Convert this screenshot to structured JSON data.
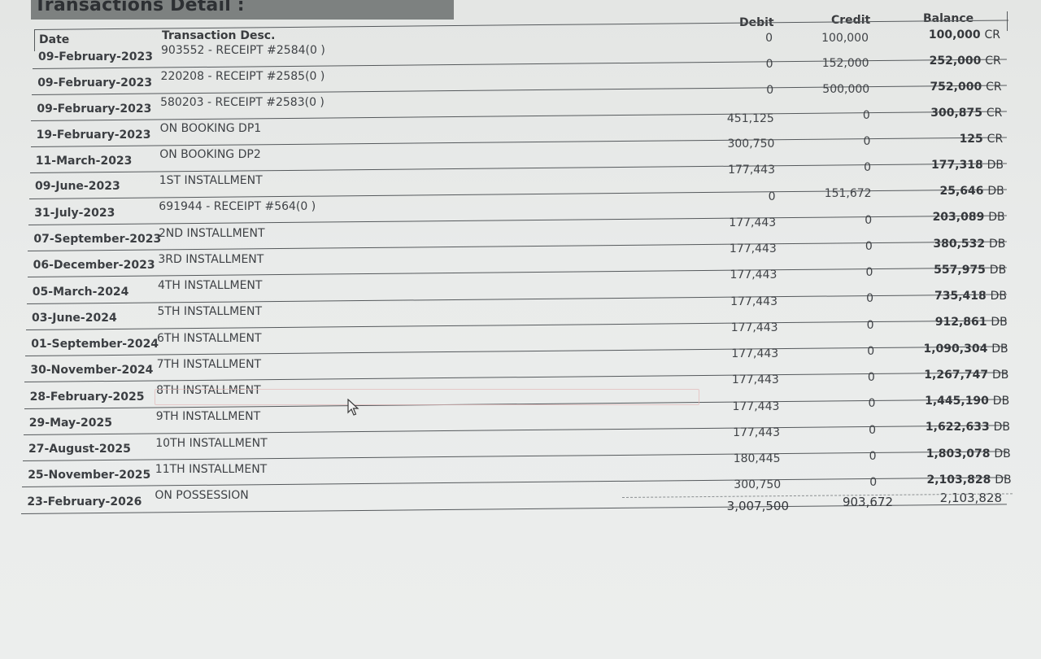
{
  "title": "Transactions Detail :",
  "columns": {
    "date": "Date",
    "desc": "Transaction Desc.",
    "debit": "Debit",
    "credit": "Credit",
    "balance": "Balance"
  },
  "rows": [
    {
      "date": "09-February-2023",
      "desc": "903552 - RECEIPT #2584(0      )",
      "debit": "0",
      "credit": "100,000",
      "balance": "100,000",
      "type": "CR"
    },
    {
      "date": "09-February-2023",
      "desc": "220208 - RECEIPT #2585(0      )",
      "debit": "0",
      "credit": "152,000",
      "balance": "252,000",
      "type": "CR"
    },
    {
      "date": "09-February-2023",
      "desc": "580203 - RECEIPT #2583(0      )",
      "debit": "0",
      "credit": "500,000",
      "balance": "752,000",
      "type": "CR"
    },
    {
      "date": "19-February-2023",
      "desc": "ON BOOKING DP1",
      "debit": "451,125",
      "credit": "0",
      "balance": "300,875",
      "type": "CR"
    },
    {
      "date": "11-March-2023",
      "desc": "ON BOOKING DP2",
      "debit": "300,750",
      "credit": "0",
      "balance": "125",
      "type": "CR"
    },
    {
      "date": "09-June-2023",
      "desc": "1ST INSTALLMENT",
      "debit": "177,443",
      "credit": "0",
      "balance": "177,318",
      "type": "DB"
    },
    {
      "date": "31-July-2023",
      "desc": "691944 - RECEIPT #564(0      )",
      "debit": "0",
      "credit": "151,672",
      "balance": "25,646",
      "type": "DB"
    },
    {
      "date": "07-September-2023",
      "desc": "2ND INSTALLMENT",
      "debit": "177,443",
      "credit": "0",
      "balance": "203,089",
      "type": "DB"
    },
    {
      "date": "06-December-2023",
      "desc": "3RD INSTALLMENT",
      "debit": "177,443",
      "credit": "0",
      "balance": "380,532",
      "type": "DB"
    },
    {
      "date": "05-March-2024",
      "desc": "4TH INSTALLMENT",
      "debit": "177,443",
      "credit": "0",
      "balance": "557,975",
      "type": "DB"
    },
    {
      "date": "03-June-2024",
      "desc": "5TH INSTALLMENT",
      "debit": "177,443",
      "credit": "0",
      "balance": "735,418",
      "type": "DB"
    },
    {
      "date": "01-September-2024",
      "desc": "6TH INSTALLMENT",
      "debit": "177,443",
      "credit": "0",
      "balance": "912,861",
      "type": "DB"
    },
    {
      "date": "30-November-2024",
      "desc": "7TH INSTALLMENT",
      "debit": "177,443",
      "credit": "0",
      "balance": "1,090,304",
      "type": "DB"
    },
    {
      "date": "28-February-2025",
      "desc": "8TH INSTALLMENT",
      "debit": "177,443",
      "credit": "0",
      "balance": "1,267,747",
      "type": "DB"
    },
    {
      "date": "29-May-2025",
      "desc": "9TH INSTALLMENT",
      "debit": "177,443",
      "credit": "0",
      "balance": "1,445,190",
      "type": "DB"
    },
    {
      "date": "27-August-2025",
      "desc": "10TH INSTALLMENT",
      "debit": "177,443",
      "credit": "0",
      "balance": "1,622,633",
      "type": "DB"
    },
    {
      "date": "25-November-2025",
      "desc": "11TH INSTALLMENT",
      "debit": "180,445",
      "credit": "0",
      "balance": "1,803,078",
      "type": "DB"
    },
    {
      "date": "23-February-2026",
      "desc": "ON POSSESSION",
      "debit": "300,750",
      "credit": "0",
      "balance": "2,103,828",
      "type": "DB"
    }
  ],
  "totals": {
    "debit": "3,007,500",
    "credit": "903,672",
    "balance": "2,103,828"
  },
  "icons": {
    "cursor": "mouse-pointer-icon"
  },
  "colors": {
    "title_bar": "#7d8180",
    "background": "#e8eae9",
    "text": "#3a3d40"
  }
}
